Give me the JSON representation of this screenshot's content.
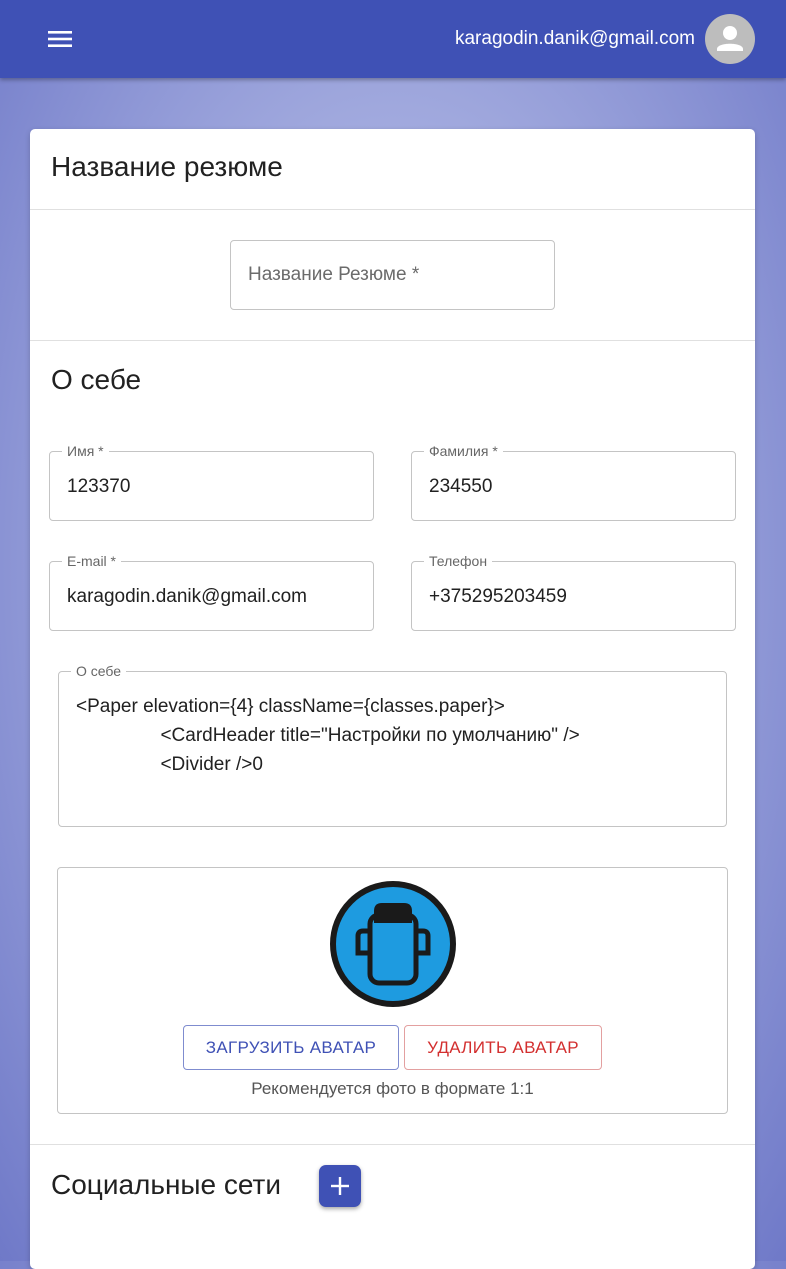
{
  "appbar": {
    "menu_icon": "menu-icon",
    "user_email": "karagodin.danik@gmail.com",
    "avatar_icon": "account-circle-icon"
  },
  "colors": {
    "primary": "#3f51b5",
    "danger": "#d32f2f",
    "avatar_blue": "#1e9be0"
  },
  "resume_title_section": {
    "title": "Название резюме",
    "input_placeholder": "Название Резюме *"
  },
  "about_section": {
    "title": "О себе",
    "first_name": {
      "label": "Имя *",
      "value": "123370"
    },
    "last_name": {
      "label": "Фамилия *",
      "value": "234550"
    },
    "email": {
      "label": "E-mail *",
      "value": "karagodin.danik@gmail.com"
    },
    "phone": {
      "label": "Телефон",
      "value": "+375295203459"
    },
    "about": {
      "label": "О себе",
      "lines": [
        "<Paper elevation={4} className={classes.paper}>",
        "                <CardHeader title=\"Настройки по умолчанию\" />",
        "                <Divider />0"
      ]
    }
  },
  "avatar_section": {
    "image_icon": "user-avatar-icon",
    "upload_label": "ЗАГРУЗИТЬ АВАТАР",
    "delete_label": "УДАЛИТЬ АВАТАР",
    "hint": "Рекомендуется фото в формате 1:1"
  },
  "social_section": {
    "title": "Социальные сети",
    "add_icon": "plus-icon"
  }
}
